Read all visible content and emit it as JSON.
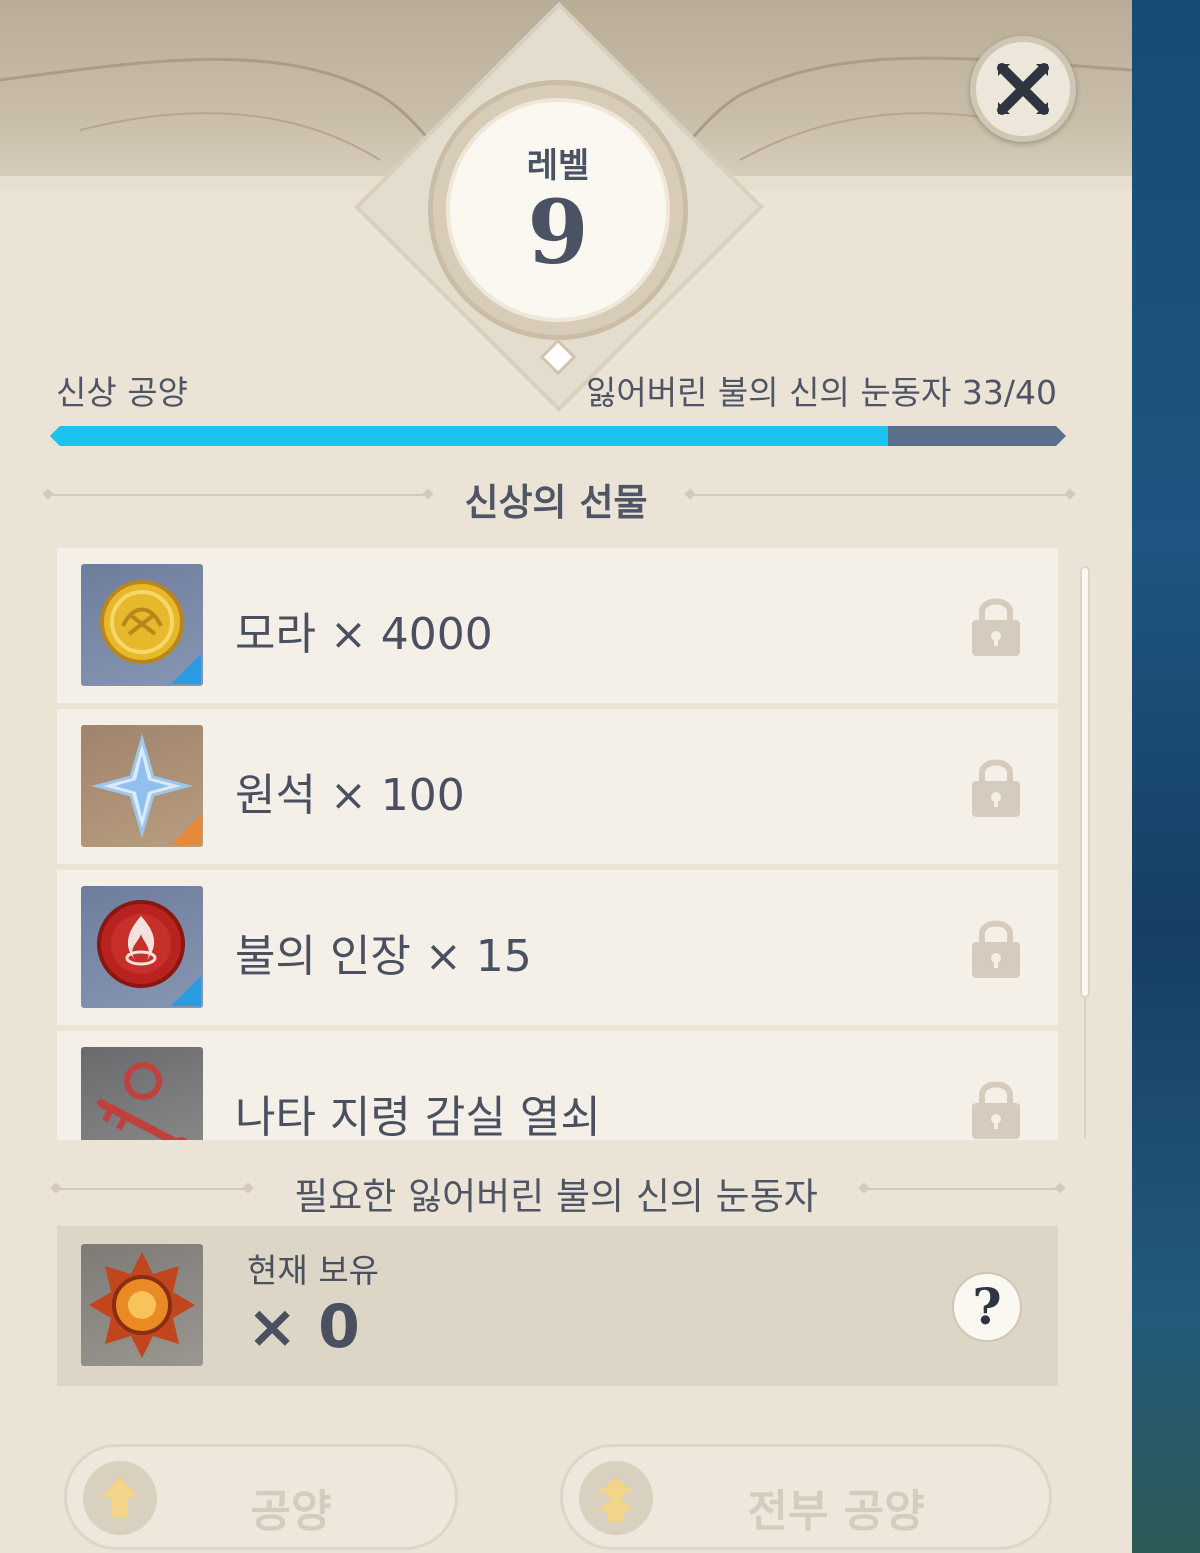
{
  "header": {
    "level_label": "레벨",
    "level_value": "9",
    "close_icon": "close-icon"
  },
  "progress": {
    "left_label": "신상 공양",
    "right_label": "잃어버린 불의 신의 눈동자 33/40",
    "current": 33,
    "max": 40,
    "fill_color": "#1ac4ee",
    "track_color": "#5a6f8c"
  },
  "gifts": {
    "title": "신상의 선물",
    "items": [
      {
        "label": "모라 × 4000",
        "icon": "mora-coin-icon",
        "rarity_color": "#2a9be0"
      },
      {
        "label": "원석 × 100",
        "icon": "primogem-icon",
        "rarity_color": "#e48a3a"
      },
      {
        "label": "불의 인장 × 15",
        "icon": "pyro-sigil-icon",
        "rarity_color": "#2a9be0"
      },
      {
        "label": "나타 지령 감실 열쇠",
        "icon": "key-icon",
        "rarity_color": ""
      }
    ]
  },
  "required": {
    "title": "필요한 잃어버린 불의 신의 눈동자",
    "held_label": "현재 보유",
    "held_value": "× 0",
    "help_label": "?"
  },
  "actions": {
    "offer_label": "공양",
    "offer_all_label": "전부 공양"
  }
}
